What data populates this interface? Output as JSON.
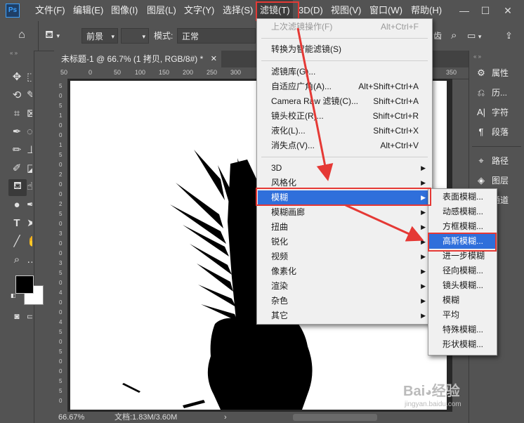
{
  "menubar": {
    "logo": "Ps",
    "items": [
      {
        "label": "文件(F)"
      },
      {
        "label": "编辑(E)"
      },
      {
        "label": "图像(I)"
      },
      {
        "label": "图层(L)"
      },
      {
        "label": "文字(Y)"
      },
      {
        "label": "选择(S)"
      },
      {
        "label": "滤镜(T)"
      },
      {
        "label": "3D(D)"
      },
      {
        "label": "视图(V)"
      },
      {
        "label": "窗口(W)"
      },
      {
        "label": "帮助(H)"
      }
    ],
    "window_controls": [
      "—",
      "☐",
      "✕"
    ]
  },
  "options_bar": {
    "fill_source": "前景",
    "mode_label": "模式:",
    "mode_value": "正常",
    "right_tail": "齿"
  },
  "document_tab": {
    "title": "未标题-1 @ 66.7% (1 拷贝, RGB/8#) *",
    "close": "✕"
  },
  "ruler": {
    "h_ticks": [
      "50",
      "0",
      "50",
      "100",
      "150",
      "200",
      "250",
      "300",
      "350"
    ],
    "v_ticks": [
      "5",
      "0",
      "5",
      "1",
      "0",
      "0",
      "1",
      "5",
      "0",
      "2",
      "0",
      "0",
      "2",
      "5",
      "0",
      "3",
      "0",
      "0",
      "3",
      "5",
      "0",
      "4",
      "0",
      "0",
      "4",
      "5",
      "0",
      "5",
      "0",
      "0",
      "5",
      "5",
      "0"
    ]
  },
  "status": {
    "zoom": "66.67%",
    "doc_info": "文档:1.83M/3.60M",
    "arrow": "›"
  },
  "right_panel": {
    "items": [
      {
        "label": "属性"
      },
      {
        "label": "历..."
      },
      {
        "label": "字符"
      },
      {
        "label": "段落"
      },
      {
        "label": "路径"
      },
      {
        "label": "图层"
      },
      {
        "label": "通道"
      }
    ]
  },
  "filter_menu": {
    "items": [
      {
        "label": "上次滤镜操作(F)",
        "shortcut": "Alt+Ctrl+F",
        "disabled": true
      },
      {
        "label": "转换为智能滤镜(S)",
        "shortcut": ""
      },
      {
        "label": "滤镜库(G)...",
        "shortcut": ""
      },
      {
        "label": "自适应广角(A)...",
        "shortcut": "Alt+Shift+Ctrl+A"
      },
      {
        "label": "Camera Raw 滤镜(C)...",
        "shortcut": "Shift+Ctrl+A"
      },
      {
        "label": "镜头校正(R)...",
        "shortcut": "Shift+Ctrl+R"
      },
      {
        "label": "液化(L)...",
        "shortcut": "Shift+Ctrl+X"
      },
      {
        "label": "消失点(V)...",
        "shortcut": "Alt+Ctrl+V"
      },
      {
        "label": "3D",
        "submenu": true
      },
      {
        "label": "风格化",
        "submenu": true
      },
      {
        "label": "模糊",
        "submenu": true,
        "highlighted": true
      },
      {
        "label": "模糊画廊",
        "submenu": true
      },
      {
        "label": "扭曲",
        "submenu": true
      },
      {
        "label": "锐化",
        "submenu": true
      },
      {
        "label": "视频",
        "submenu": true
      },
      {
        "label": "像素化",
        "submenu": true
      },
      {
        "label": "渲染",
        "submenu": true
      },
      {
        "label": "杂色",
        "submenu": true
      },
      {
        "label": "其它",
        "submenu": true
      }
    ]
  },
  "blur_menu": {
    "items": [
      {
        "label": "表面模糊..."
      },
      {
        "label": "动感模糊..."
      },
      {
        "label": "方框模糊..."
      },
      {
        "label": "高斯模糊...",
        "highlighted": true
      },
      {
        "label": "进一步模糊"
      },
      {
        "label": "径向模糊..."
      },
      {
        "label": "镜头模糊..."
      },
      {
        "label": "模糊"
      },
      {
        "label": "平均"
      },
      {
        "label": "特殊模糊..."
      },
      {
        "label": "形状模糊..."
      }
    ]
  },
  "watermark": {
    "brand": "Bai",
    "brand2": "经验",
    "url": "jingyan.baidu.com"
  },
  "colors": {
    "highlight": "#2f6fdb",
    "annotation": "#e53935",
    "foreground": "#000000",
    "background": "#ffffff"
  }
}
